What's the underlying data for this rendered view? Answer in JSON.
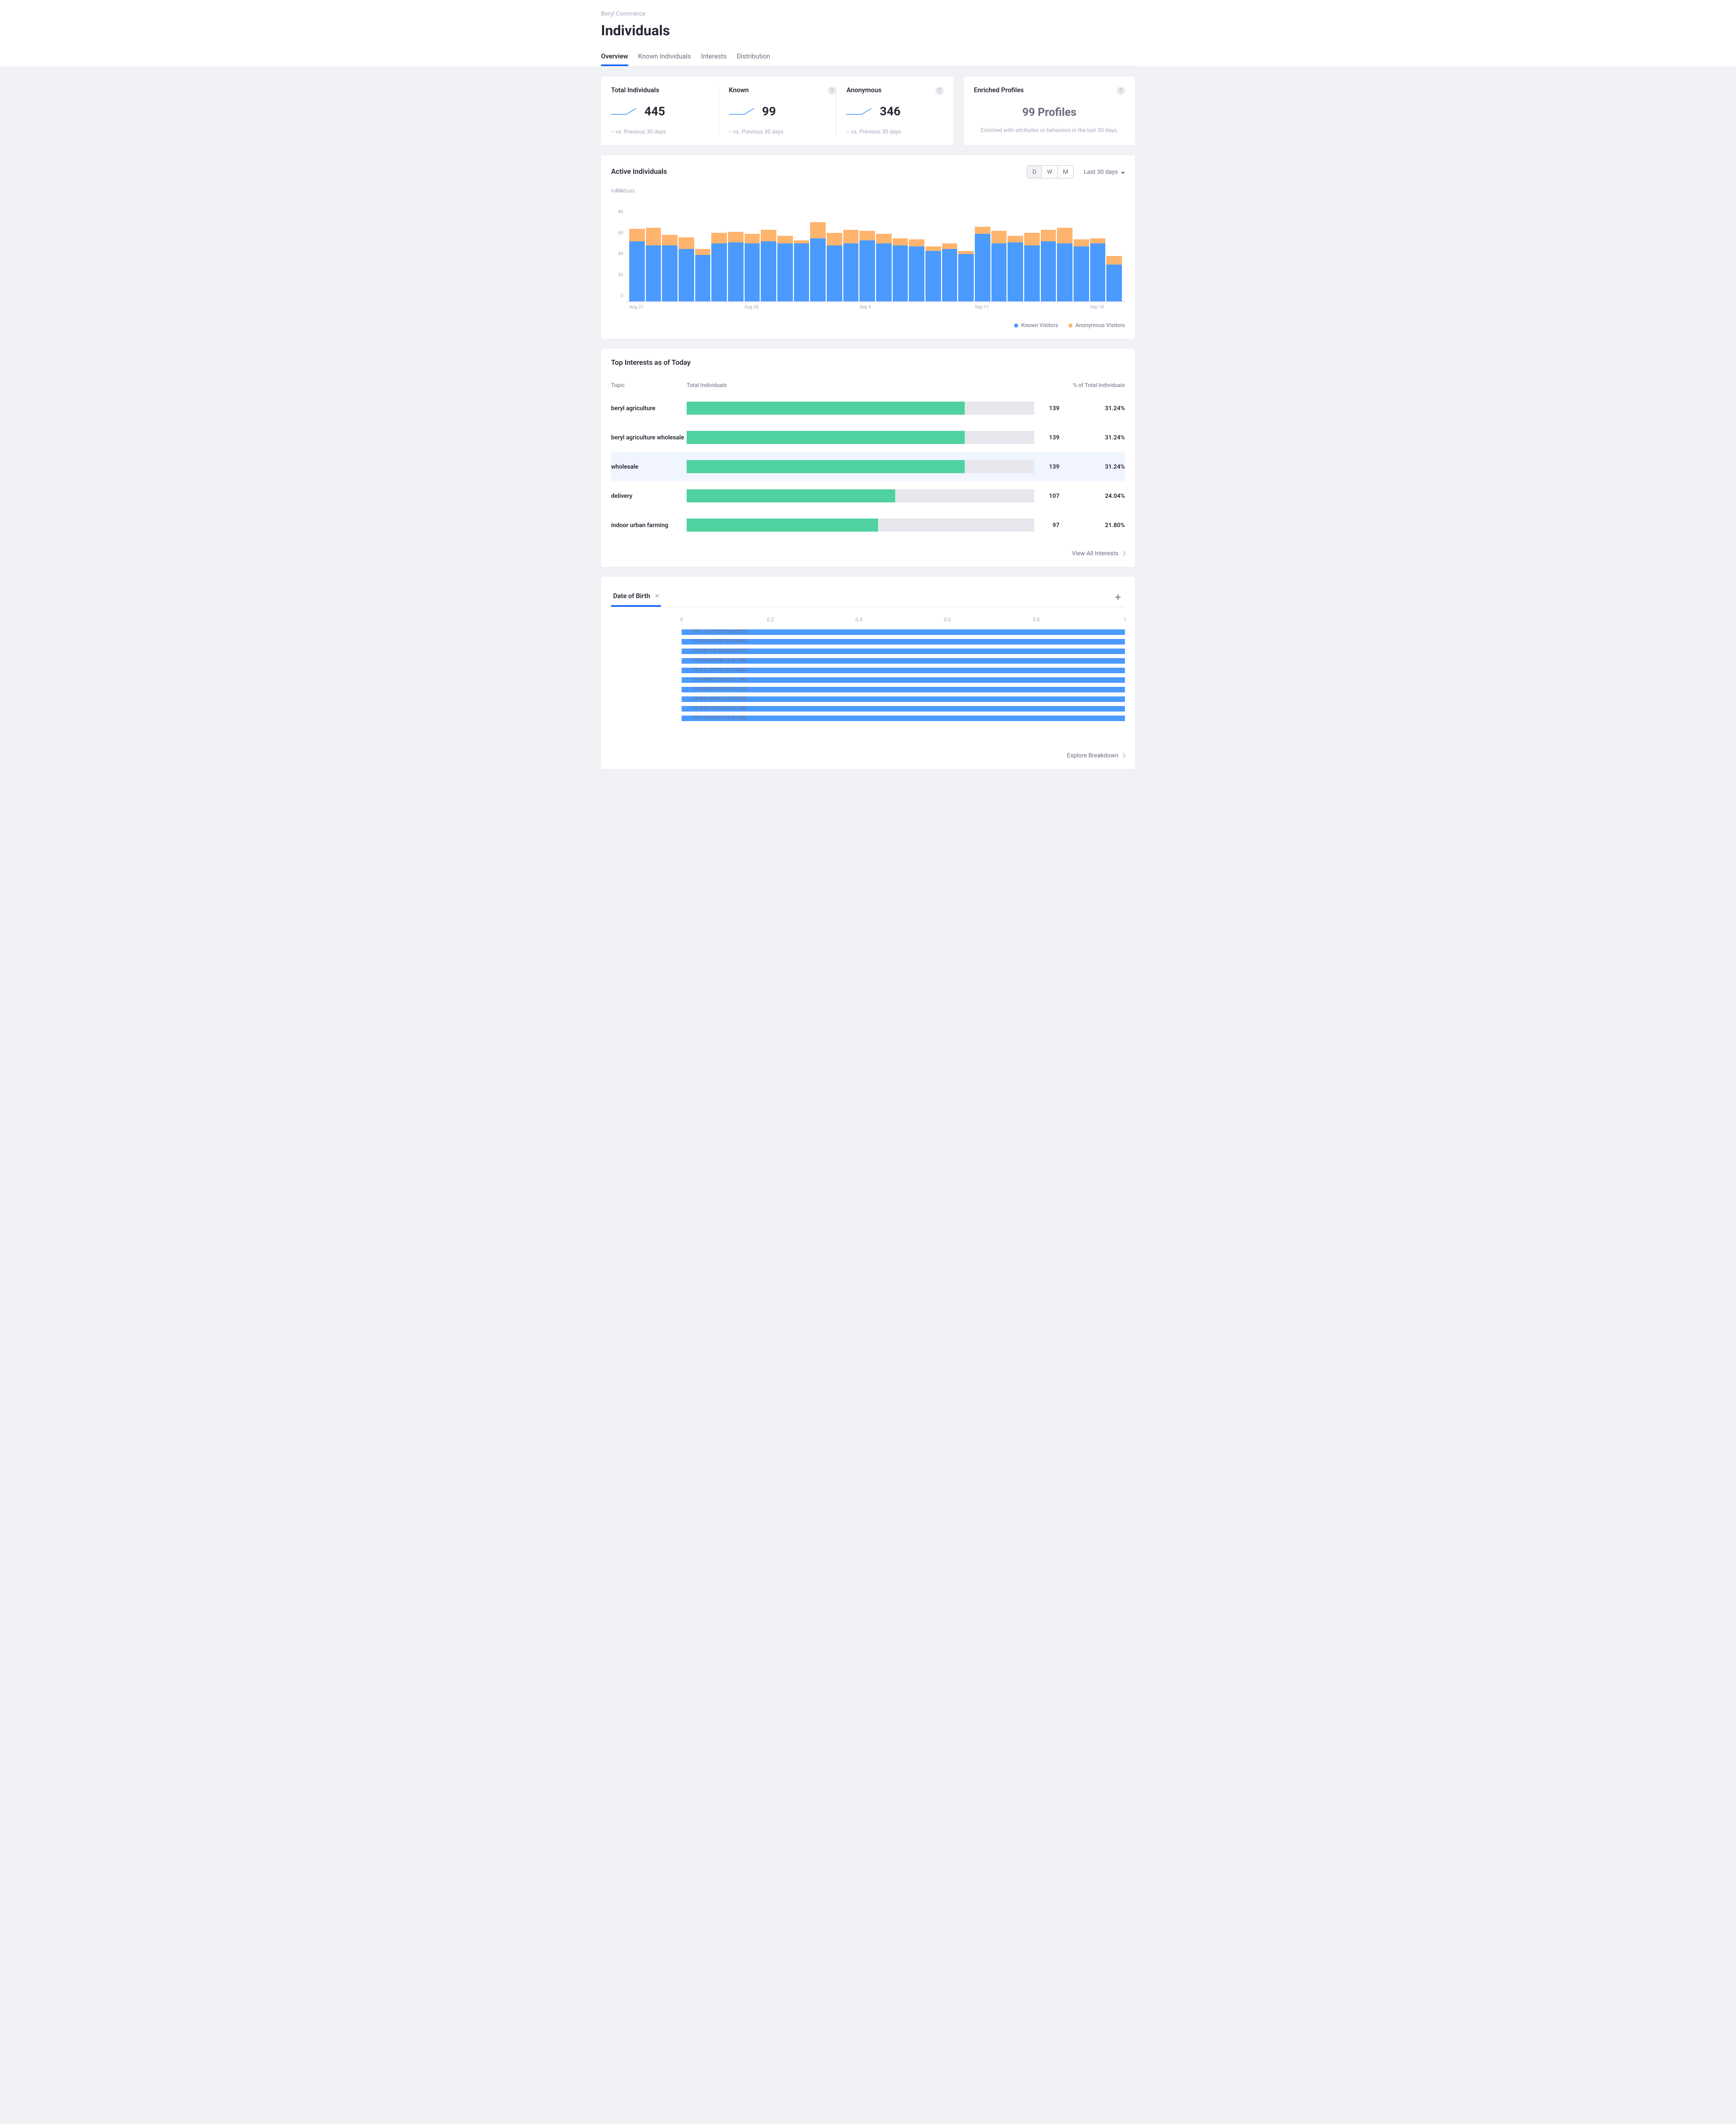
{
  "breadcrumb": "Beryl Commerce",
  "page_title": "Individuals",
  "tabs": [
    {
      "label": "Overview",
      "active": true
    },
    {
      "label": "Known Individuals",
      "active": false
    },
    {
      "label": "Interests",
      "active": false
    },
    {
      "label": "Distribution",
      "active": false
    }
  ],
  "stat_cards": {
    "total": {
      "title": "Total Individuals",
      "value": "445",
      "sub": "-- vs. Previous 30 days"
    },
    "known": {
      "title": "Known",
      "value": "99",
      "sub": "-- vs. Previous 30 days"
    },
    "anonymous": {
      "title": "Anonymous",
      "value": "346",
      "sub": "-- vs. Previous 30 days"
    }
  },
  "enriched": {
    "title": "Enriched Profiles",
    "value": "99 Profiles",
    "sub": "Enriched with attributes or behaviors in the last 30 days."
  },
  "active_card": {
    "title": "Active Individuals",
    "seg": [
      {
        "label": "D",
        "active": true
      },
      {
        "label": "W",
        "active": false
      },
      {
        "label": "M",
        "active": false
      }
    ],
    "time_label": "Last 30 days",
    "legend_known": "Known Visitors",
    "legend_anon": "Anonymous Visitors",
    "ylabel": "Individuals"
  },
  "chart_data": {
    "type": "bar",
    "ylabel": "Individuals",
    "ylim": [
      0,
      100
    ],
    "yticks": [
      0,
      20,
      40,
      60,
      80,
      100
    ],
    "x_tick_labels": {
      "0": "Aug 21",
      "7": "Aug 28",
      "14": "Sep 4",
      "21": "Sep 11",
      "28": "Sep 18"
    },
    "series": [
      {
        "name": "Known Visitors",
        "color": "#4b9bff",
        "values": [
          57,
          53,
          53,
          50,
          44,
          55,
          56,
          55,
          57,
          55,
          55,
          60,
          53,
          55,
          58,
          55,
          53,
          52,
          48,
          50,
          45,
          64,
          55,
          56,
          53,
          57,
          55,
          52,
          55,
          35
        ]
      },
      {
        "name": "Anonymous Visitors",
        "color": "#ffb46e",
        "values": [
          12,
          17,
          10,
          11,
          6,
          10,
          10,
          9,
          11,
          7,
          3,
          15,
          12,
          13,
          9,
          9,
          7,
          7,
          4,
          5,
          3,
          7,
          12,
          6,
          12,
          11,
          15,
          7,
          5,
          8
        ]
      }
    ]
  },
  "interests": {
    "title": "Top Interests as of Today",
    "col_topic": "Topic",
    "col_total": "Total Individuals",
    "col_pct": "% of Total Individuals",
    "rows": [
      {
        "topic": "beryl agriculture",
        "count": "139",
        "pct": "31.24%",
        "width": 80,
        "hl": false
      },
      {
        "topic": "beryl agriculture wholesale",
        "count": "139",
        "pct": "31.24%",
        "width": 80,
        "hl": false
      },
      {
        "topic": "wholesale",
        "count": "139",
        "pct": "31.24%",
        "width": 80,
        "hl": true
      },
      {
        "topic": "delivery",
        "count": "107",
        "pct": "24.04%",
        "width": 60,
        "hl": false
      },
      {
        "topic": "indoor urban farming",
        "count": "97",
        "pct": "21.80%",
        "width": 55,
        "hl": false
      }
    ],
    "footer_link": "View All Interests"
  },
  "dob": {
    "tab_label": "Date of Birth",
    "xticks": [
      {
        "label": "0",
        "pos": 0
      },
      {
        "label": "0.2",
        "pos": 20
      },
      {
        "label": "0.4",
        "pos": 40
      },
      {
        "label": "0.6",
        "pos": 60
      },
      {
        "label": "0.8",
        "pos": 80
      },
      {
        "label": "1",
        "pos": 100
      }
    ],
    "rows": [
      {
        "label": "1971-10-27T07:35:06.672Z",
        "value": 1
      },
      {
        "label": "1972-04-14T00:30:35.834Z",
        "value": 1
      },
      {
        "label": "1972-07-14T13:36:14.617Z",
        "value": 1
      },
      {
        "label": "1972-08-25T08:14:30.205Z",
        "value": 1
      },
      {
        "label": "1972-11-23T00:16:31.884Z",
        "value": 1
      },
      {
        "label": "1973-08-05T23:54:25.164Z",
        "value": 1
      },
      {
        "label": "1974-08-03T20:07:33.315Z",
        "value": 1
      },
      {
        "label": "1976-01-24T17:47:02.075Z",
        "value": 1
      },
      {
        "label": "1976-05-16T13:27:24.265Z",
        "value": 1
      },
      {
        "label": "1977-10-04T01:14:39.390Z",
        "value": 1
      }
    ],
    "footer_link": "Explore Breakdown"
  },
  "colors": {
    "known": "#4b9bff",
    "anon": "#ffb46e",
    "interest": "#50d2a0"
  }
}
